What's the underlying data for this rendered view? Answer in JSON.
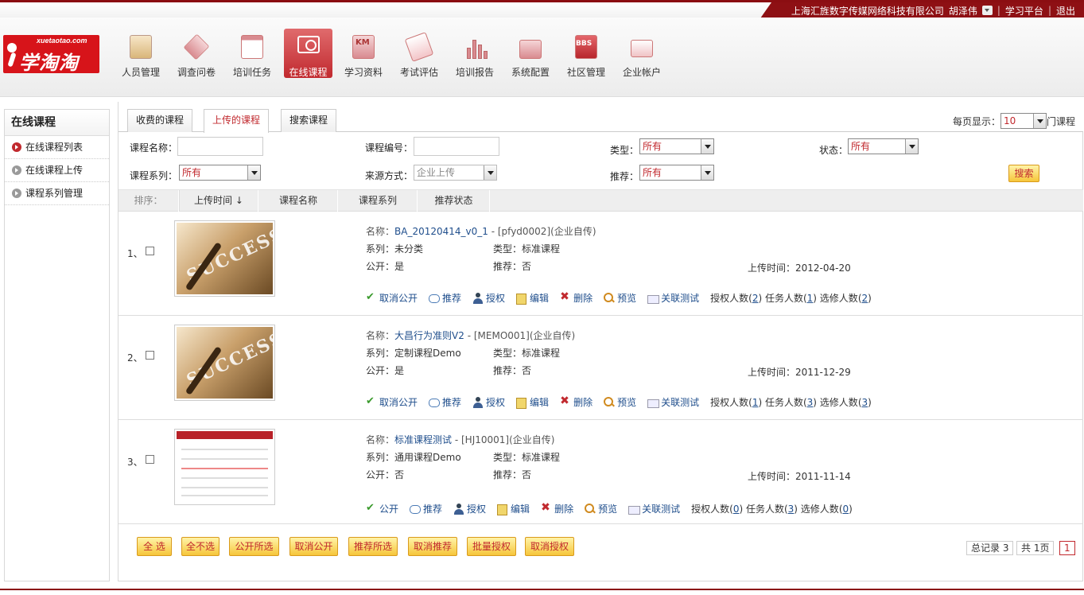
{
  "topbar": {
    "company": "上海汇旌数字传媒网络科技有限公司",
    "user": "胡泽伟",
    "learning_platform": "学习平台",
    "logout": "退出"
  },
  "logo": {
    "url_text": "xuetaotao.com",
    "name": "学淘淘"
  },
  "nav": [
    {
      "label": "人员管理",
      "icon": "people-icon"
    },
    {
      "label": "调查问卷",
      "icon": "survey-icon"
    },
    {
      "label": "培训任务",
      "icon": "calendar-icon"
    },
    {
      "label": "在线课程",
      "icon": "screen-play-icon"
    },
    {
      "label": "学习资料",
      "icon": "km-icon"
    },
    {
      "label": "考试评估",
      "icon": "exam-icon"
    },
    {
      "label": "培训报告",
      "icon": "bar-chart-icon"
    },
    {
      "label": "系统配置",
      "icon": "gear-folder-icon"
    },
    {
      "label": "社区管理",
      "icon": "bbs-icon"
    },
    {
      "label": "企业帐户",
      "icon": "account-icon"
    }
  ],
  "sidebar": {
    "title": "在线课程",
    "items": [
      {
        "label": "在线课程列表"
      },
      {
        "label": "在线课程上传"
      },
      {
        "label": "课程系列管理"
      }
    ]
  },
  "tabs": [
    {
      "label": "收费的课程"
    },
    {
      "label": "上传的课程"
    },
    {
      "label": "搜索课程"
    }
  ],
  "perpage": {
    "label": "每页显示：",
    "value": "10",
    "suffix": "门课程"
  },
  "filters": {
    "name_label": "课程名称：",
    "code_label": "课程编号：",
    "type_label": "类型：",
    "type_value": "所有",
    "status_label": "状态：",
    "status_value": "所有",
    "series_label": "课程系列：",
    "series_value": "所有",
    "source_label": "来源方式：",
    "source_value": "企业上传",
    "recommend_label": "推荐：",
    "recommend_value": "所有",
    "search_button": "搜索"
  },
  "sort": {
    "label": "排序：",
    "columns": [
      "上传时间",
      "课程名称",
      "课程系列",
      "推荐状态"
    ],
    "arrow": "↓"
  },
  "labels": {
    "name": "名称：",
    "series": "系列：",
    "type": "类型：",
    "public": "公开：",
    "recommend": "推荐：",
    "upload_time": "上传时间：",
    "auth_count": "授权人数",
    "task_count": "任务人数",
    "elective_count": "选修人数"
  },
  "courses": [
    {
      "index": "1、",
      "title": "BA_20120414_v0_1",
      "code": "[pfyd0002]",
      "source": "(企业自传)",
      "series": "未分类",
      "type": "标准课程",
      "public": "是",
      "recommend": "否",
      "upload_time": "2012-04-20",
      "toggle_public": "取消公开",
      "actions": [
        "推荐",
        "授权",
        "编辑",
        "删除",
        "预览",
        "关联测试"
      ],
      "auth": "2",
      "task": "1",
      "elective": "2"
    },
    {
      "index": "2、",
      "title": "大昌行为准则V2",
      "code": "[MEMO001]",
      "source": "(企业自传)",
      "series": "定制课程Demo",
      "type": "标准课程",
      "public": "是",
      "recommend": "否",
      "upload_time": "2011-12-29",
      "toggle_public": "取消公开",
      "actions": [
        "推荐",
        "授权",
        "编辑",
        "删除",
        "预览",
        "关联测试"
      ],
      "auth": "1",
      "task": "3",
      "elective": "3"
    },
    {
      "index": "3、",
      "title": "标准课程测试",
      "code": "[HJ10001]",
      "source": "(企业自传)",
      "series": "通用课程Demo",
      "type": "标准课程",
      "public": "否",
      "recommend": "否",
      "upload_time": "2011-11-14",
      "toggle_public": "公开",
      "actions": [
        "推荐",
        "授权",
        "编辑",
        "删除",
        "预览",
        "关联测试"
      ],
      "auth": "0",
      "task": "3",
      "elective": "0"
    }
  ],
  "bulk_buttons": [
    "全 选",
    "全不选",
    "公开所选",
    "取消公开",
    "推荐所选",
    "取消推荐",
    "批量授权",
    "取消授权"
  ],
  "pagination": {
    "total": "总记录 3",
    "pages": "共 1页",
    "current": "1"
  },
  "colors": {
    "brand_red": "#c1292e",
    "dark_red": "#8e1014",
    "link_blue": "#1f4e8c",
    "button_yellow": "#f6c63b"
  }
}
